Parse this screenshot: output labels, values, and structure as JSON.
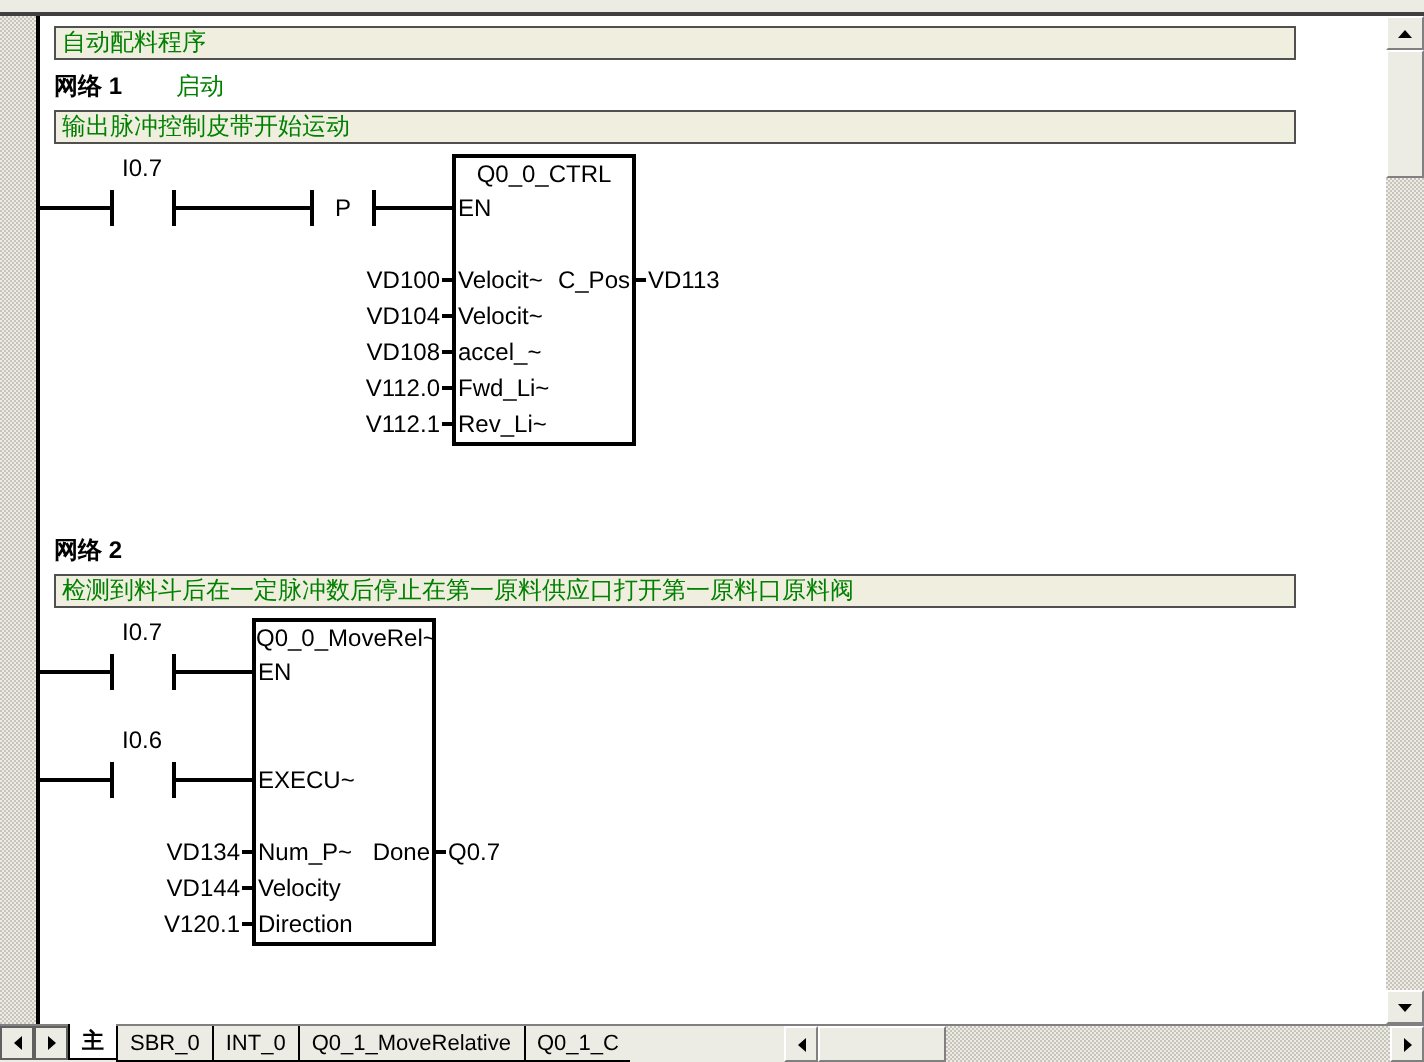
{
  "program_comment": "自动配料程序",
  "networks": [
    {
      "label": "网络 1",
      "title": "启动",
      "comment": "输出脉冲控制皮带开始运动",
      "rungs": [
        [
          {
            "kind": "contact",
            "label": "I0.7"
          },
          {
            "kind": "edge",
            "symbol": "P"
          }
        ]
      ],
      "block": {
        "title": "Q0_0_CTRL",
        "inputs": [
          {
            "pin": "EN"
          },
          {
            "pin": "Velocit~",
            "operand": "VD100"
          },
          {
            "pin": "Velocit~",
            "operand": "VD104"
          },
          {
            "pin": "accel_~",
            "operand": "VD108"
          },
          {
            "pin": "Fwd_Li~",
            "operand": "V112.0"
          },
          {
            "pin": "Rev_Li~",
            "operand": "V112.1"
          }
        ],
        "outputs": [
          {
            "pin": "C_Pos",
            "operand": "VD113"
          }
        ]
      }
    },
    {
      "label": "网络 2",
      "comment": "检测到料斗后在一定脉冲数后停止在第一原料供应口打开第一原料口原料阀",
      "rungs": [
        [
          {
            "kind": "contact",
            "label": "I0.7"
          }
        ],
        [
          {
            "kind": "contact",
            "label": "I0.6"
          }
        ]
      ],
      "block": {
        "title": "Q0_0_MoveRel~",
        "inputs": [
          {
            "pin": "EN"
          },
          {
            "pin": "EXECU~"
          },
          {
            "pin": "Num_P~",
            "operand": "VD134"
          },
          {
            "pin": "Velocity",
            "operand": "VD144"
          },
          {
            "pin": "Direction",
            "operand": "V120.1"
          }
        ],
        "outputs": [
          {
            "pin": "Done",
            "operand": "Q0.7"
          }
        ]
      }
    }
  ],
  "tabs": [
    {
      "label": "主",
      "selected": true
    },
    {
      "label": "SBR_0",
      "selected": false
    },
    {
      "label": "INT_0",
      "selected": false
    },
    {
      "label": "Q0_1_MoveRelative",
      "selected": false
    },
    {
      "label": "Q0_1_C",
      "selected": false
    }
  ]
}
